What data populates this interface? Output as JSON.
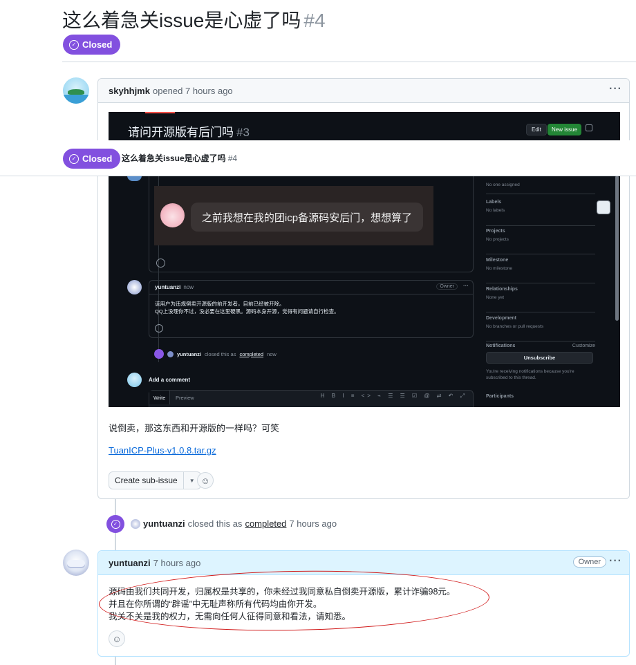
{
  "issue": {
    "title": "这么着急关issue是心虚了吗",
    "number": "#4",
    "state": "Closed"
  },
  "sticky": {
    "state": "Closed",
    "title": "这么着急关issue是心虚了吗",
    "number": "#4"
  },
  "first_comment": {
    "author": "skyhhjmk",
    "action": "opened",
    "time": "7 hours ago",
    "more_icon": "kebab-horizontal-icon",
    "body_text": "说倒卖，那这东西和开源版的一样吗？可笑",
    "attachment": "TuanICP-Plus-v1.0.8.tar.gz",
    "create_sub_issue": "Create sub-issue",
    "dropdown_icon": "triangle-down-icon",
    "emoji_icon": "smiley-icon"
  },
  "screenshot": {
    "title": "请问开源版有后门吗",
    "number": "#3",
    "edit": "Edit",
    "new_issue": "New issue",
    "chat_bubble": "之前我想在我的团icp备源码安后门，想想算了",
    "reply_author": "yuntuanzi",
    "reply_time": "now",
    "reply_owner": "Owner",
    "reply_line1": "该用户为违规倒卖开源版的前开发者，目前已经被开除。",
    "reply_line2": "QQ上没理你不过，没必要在这里硬黑。源码本身开源，觉得有问题请自行检查。",
    "closed_author": "yuntuanzi",
    "closed_text": "closed this as",
    "closed_reason": "completed",
    "closed_time": "now",
    "add_comment": "Add a comment",
    "write_tab": "Write",
    "preview_tab": "Preview",
    "toolbar": "H B I ≡ <> ⌁ ☰ ☰ ☑ @ ⇄ ↶ ⤢",
    "sidebar": {
      "assignees_value": "No one assigned",
      "labels_label": "Labels",
      "labels_value": "No labels",
      "projects_label": "Projects",
      "projects_value": "No projects",
      "milestone_label": "Milestone",
      "milestone_value": "No milestone",
      "relationships_label": "Relationships",
      "relationships_value": "None yet",
      "development_label": "Development",
      "development_value": "No branches or pull requests",
      "notifications_label": "Notifications",
      "customize": "Customize",
      "unsubscribe": "Unsubscribe",
      "notification_note": "You're receiving notifications because you're subscribed to this thread.",
      "participants_label": "Participants"
    }
  },
  "timeline_event": {
    "author": "yuntuanzi",
    "action": "closed this as",
    "reason": "completed",
    "time": "7 hours ago"
  },
  "owner_comment": {
    "author": "yuntuanzi",
    "time": "7 hours ago",
    "badge": "Owner",
    "more_icon": "kebab-horizontal-icon",
    "line1": "源码由我们共同开发，归属权是共享的，你未经过我同意私自倒卖开源版，累计诈骗98元。",
    "line2": "并且在你所谓的“辟谣”中无耻声称所有代码均由你开发。",
    "line3": "我关不关是我的权力，无需向任何人征得同意和看法，请知悉。",
    "emoji_icon": "smiley-icon"
  },
  "colors": {
    "closed_purple": "#8250df",
    "link_blue": "#0969da",
    "annotation_red": "#d11a1a",
    "owner_header": "#ddf4ff"
  }
}
